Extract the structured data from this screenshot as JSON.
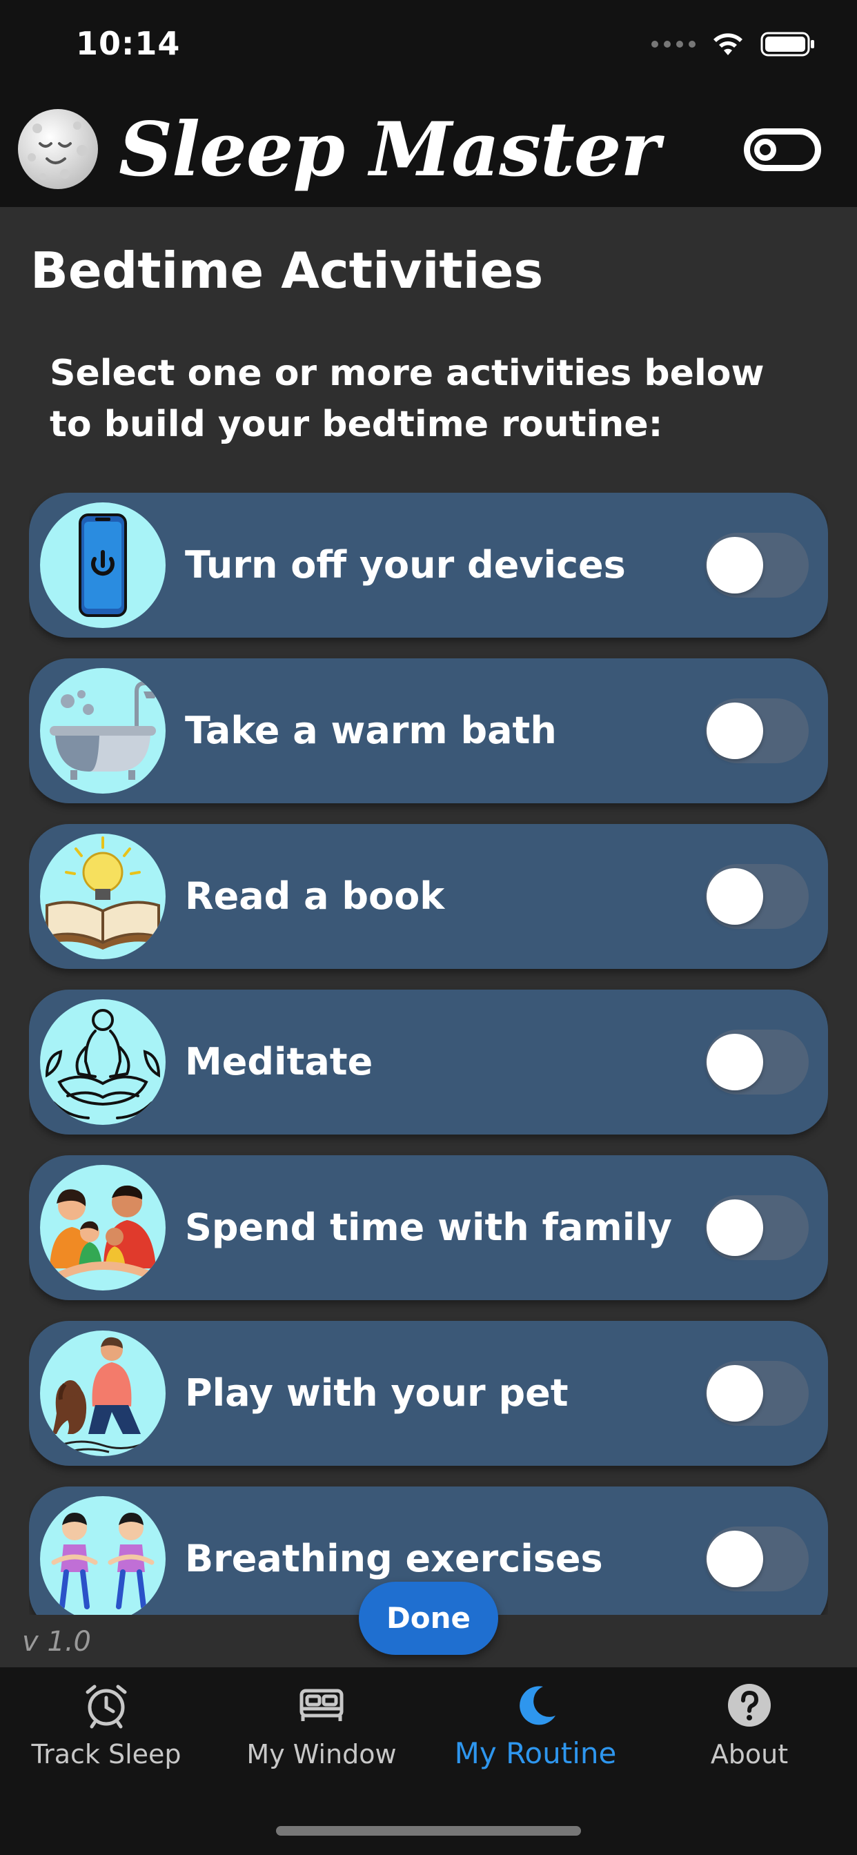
{
  "status_bar": {
    "time": "10:14"
  },
  "header": {
    "title": "Sleep Master"
  },
  "page": {
    "title": "Bedtime Activities",
    "instructions": "Select one or more activities below to build your bedtime routine:"
  },
  "activities": [
    {
      "label": "Turn off your devices",
      "icon": "phone-power-icon",
      "enabled": false
    },
    {
      "label": "Take a warm bath",
      "icon": "bathtub-icon",
      "enabled": false
    },
    {
      "label": "Read a book",
      "icon": "book-lightbulb-icon",
      "enabled": false
    },
    {
      "label": "Meditate",
      "icon": "meditation-icon",
      "enabled": false
    },
    {
      "label": "Spend time with family",
      "icon": "family-icon",
      "enabled": false
    },
    {
      "label": "Play with your pet",
      "icon": "pet-icon",
      "enabled": false
    },
    {
      "label": "Breathing exercises",
      "icon": "breathing-kids-icon",
      "enabled": false
    }
  ],
  "done_label": "Done",
  "version": "v 1.0",
  "tabs": [
    {
      "label": "Track Sleep",
      "icon": "alarm-clock-icon",
      "active": false
    },
    {
      "label": "My Window",
      "icon": "bed-icon",
      "active": false
    },
    {
      "label": "My Routine",
      "icon": "moon-icon",
      "active": true
    },
    {
      "label": "About",
      "icon": "question-icon",
      "active": false
    }
  ],
  "colors": {
    "background": "#2f2f2f",
    "header": "#121212",
    "card": "#3b5877",
    "icon_bg": "#a8f3f7",
    "accent": "#2e96ee",
    "done_button": "#1f6fd0"
  }
}
